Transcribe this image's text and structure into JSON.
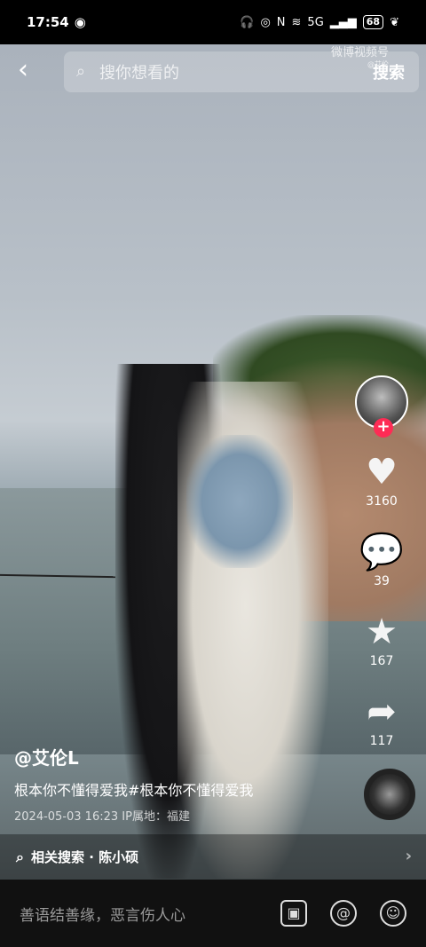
{
  "status_bar": {
    "time": "17:54",
    "battery": "68",
    "network": "5G"
  },
  "search_bar": {
    "placeholder": "搜你想看的",
    "button": "搜索",
    "watermark": "微博视频号",
    "watermark_sub": "@艾伦"
  },
  "side_actions": {
    "likes": "3160",
    "comments": "39",
    "favorites": "167",
    "shares": "117"
  },
  "post": {
    "username": "@艾伦L",
    "description": "根本你不懂得爱我#根本你不懂得爱我",
    "timestamp": "2024-05-03 16:23",
    "location": "IP属地：福建"
  },
  "related_search": {
    "label": "相关搜索 · 陈小硕"
  },
  "comment_bar": {
    "placeholder": "善语结善缘，恶言伤人心"
  }
}
